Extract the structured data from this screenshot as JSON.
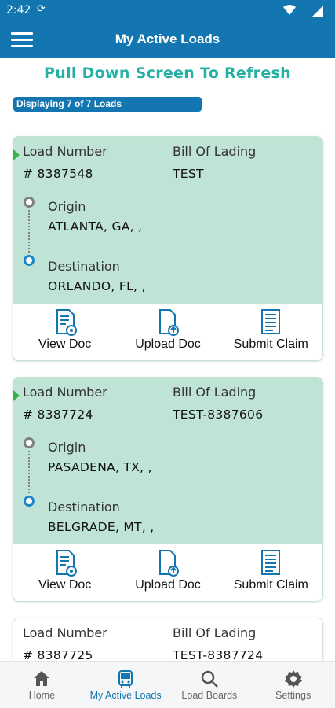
{
  "status_bar": {
    "time": "2:42",
    "sync_glyph": "⟳"
  },
  "header": {
    "title": "My Active Loads"
  },
  "refresh_hint": "Pull Down Screen To Refresh",
  "count_text": "Displaying 7 of 7 Loads",
  "labels": {
    "load_number": "Load Number",
    "bill_of_lading": "Bill Of Lading",
    "origin": "Origin",
    "destination": "Destination"
  },
  "actions": {
    "view_doc": "View Doc",
    "upload_doc": "Upload Doc",
    "submit_claim": "Submit Claim"
  },
  "loads": [
    {
      "load_number": "# 8387548",
      "bol": "TEST",
      "origin": "ATLANTA, GA, ,",
      "destination": "ORLANDO, FL, ,"
    },
    {
      "load_number": "# 8387724",
      "bol": "TEST-8387606",
      "origin": "PASADENA, TX, ,",
      "destination": "BELGRADE, MT, ,"
    },
    {
      "load_number": "# 8387725",
      "bol": "TEST-8387724"
    }
  ],
  "bottom_nav": [
    {
      "label": "Home",
      "icon": "home-icon"
    },
    {
      "label": "My Active Loads",
      "icon": "bus-icon",
      "active": true
    },
    {
      "label": "Load Boards",
      "icon": "search-icon"
    },
    {
      "label": "Settings",
      "icon": "gear-icon"
    }
  ],
  "colors": {
    "primary": "#1376b0",
    "card_bg": "#bfe3d4",
    "hint": "#26b0a5",
    "marker": "#37b34a"
  }
}
